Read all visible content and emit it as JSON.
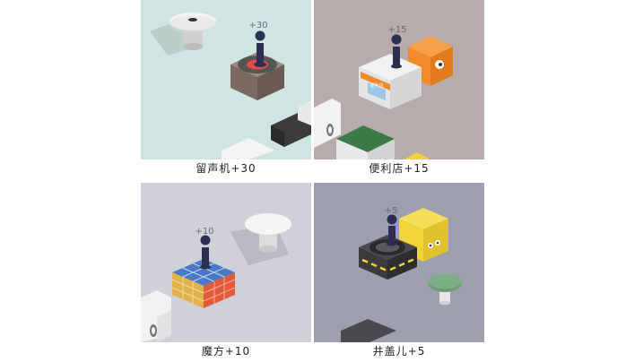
{
  "panels": [
    {
      "caption": "留声机+30",
      "score_popup": "+30",
      "background": "#cfe5e1"
    },
    {
      "caption": "便利店+15",
      "score_popup": "+15",
      "background": "#b7abab",
      "sign_text": "便利店"
    },
    {
      "caption": "魔方+10",
      "score_popup": "+10",
      "background": "#cfd0d8"
    },
    {
      "caption": "井盖儿+5",
      "score_popup": "+5",
      "background": "#9d9fae"
    }
  ],
  "colors": {
    "piece": "#2c2e52",
    "record_player": "#7b6a62",
    "store_awning": "#f18a2a",
    "cube_blue": "#4878c8",
    "cube_brick": "#e25a3a",
    "manhole_box": "#3b3b3e",
    "yellow_cube": "#f1d33a"
  }
}
